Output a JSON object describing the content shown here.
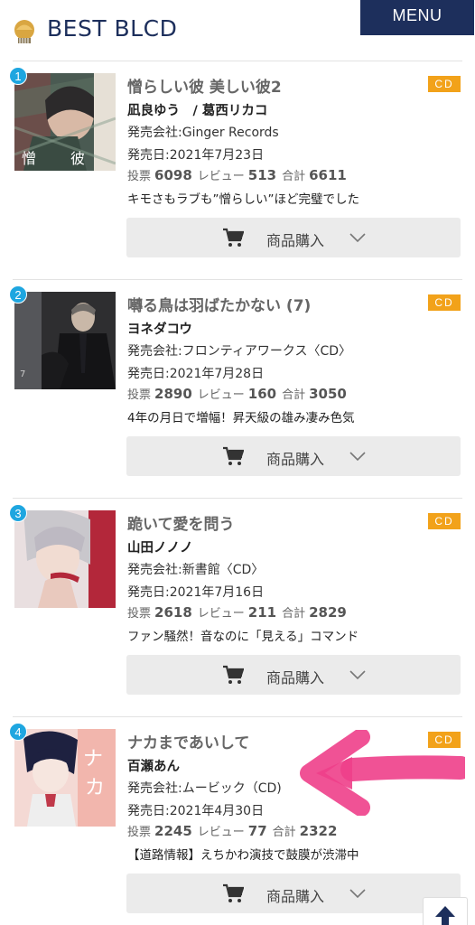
{
  "header": {
    "title": "BEST BLCD",
    "menu_label": "MENU",
    "logo_icon": "gold-shell-icon"
  },
  "items": [
    {
      "rank": "1",
      "title": "憎らしい彼 美しい彼2",
      "tag": "CD",
      "author": "凪良ゆう　/ 葛西リカコ",
      "publisher": "発売会社:Ginger Records",
      "release": "発売日:2021年7月23日",
      "votes_label": "投票",
      "votes": "6098",
      "reviews_label": "レビュー",
      "reviews": "513",
      "total_label": "合計",
      "total": "6611",
      "comment": "キモさもラブも”憎らしい”ほど完璧でした",
      "buy_label": "商品購入"
    },
    {
      "rank": "2",
      "title": "囀る鳥は羽ばたかない (7)",
      "tag": "CD",
      "author": "ヨネダコウ",
      "publisher": "発売会社:フロンティアワークス〈CD〉",
      "release": "発売日:2021年7月28日",
      "votes_label": "投票",
      "votes": "2890",
      "reviews_label": "レビュー",
      "reviews": "160",
      "total_label": "合計",
      "total": "3050",
      "comment": "4年の月日で増幅！昇天級の雄み凄み色気",
      "buy_label": "商品購入"
    },
    {
      "rank": "3",
      "title": "跪いて愛を問う",
      "tag": "CD",
      "author": "山田ノノノ",
      "publisher": "発売会社:新書館〈CD〉",
      "release": "発売日:2021年7月16日",
      "votes_label": "投票",
      "votes": "2618",
      "reviews_label": "レビュー",
      "reviews": "211",
      "total_label": "合計",
      "total": "2829",
      "comment": "ファン騒然！音なのに「見える」コマンド",
      "buy_label": "商品購入"
    },
    {
      "rank": "4",
      "title": "ナカまであいして",
      "tag": "CD",
      "author": "百瀬あん",
      "publisher": "発売会社:ムービック（CD)",
      "release": "発売日:2021年4月30日",
      "votes_label": "投票",
      "votes": "2245",
      "reviews_label": "レビュー",
      "reviews": "77",
      "total_label": "合計",
      "total": "2322",
      "comment": "【道路情報】えちかわ演技で鼓膜が渋滞中",
      "buy_label": "商品購入"
    }
  ],
  "icons": {
    "cart": "shopping-cart-icon",
    "chevron": "chevron-down-icon",
    "scroll_top": "arrow-up-icon"
  },
  "colors": {
    "brand_navy": "#1d2f5c",
    "rank_badge": "#1ea6e0",
    "cd_tag": "#f2a21a",
    "button_bg": "#ebebeb",
    "annotation_arrow": "#ee3f8a"
  }
}
